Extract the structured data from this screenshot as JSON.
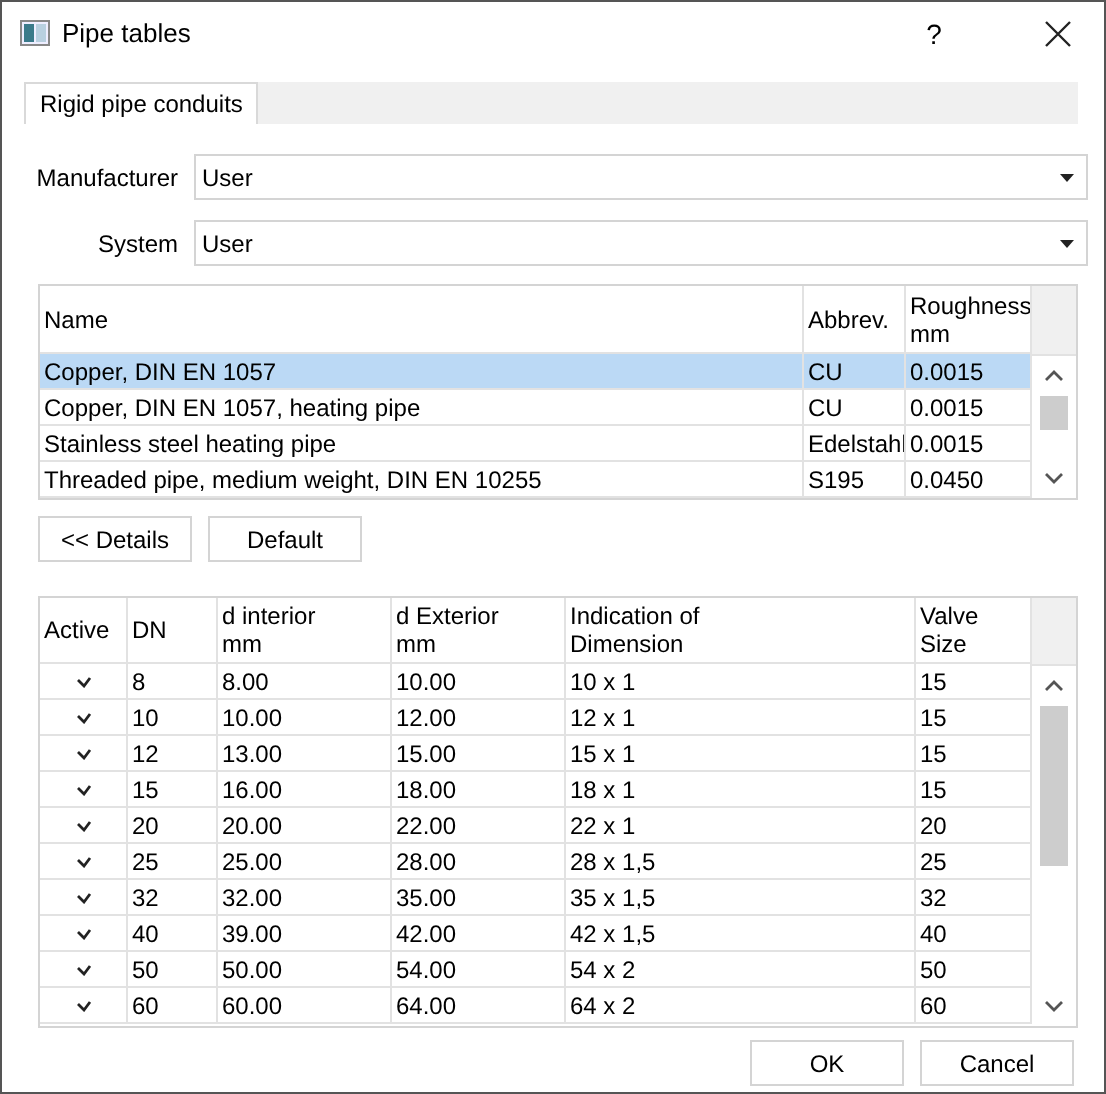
{
  "window": {
    "title": "Pipe tables",
    "help": "?"
  },
  "tabs": [
    {
      "label": "Rigid pipe conduits",
      "selected": true
    }
  ],
  "fields": [
    {
      "label": "Manufacturer",
      "value": "User"
    },
    {
      "label": "System",
      "value": "User"
    }
  ],
  "materials": {
    "columns": [
      "Name",
      "Abbrev.",
      "Roughness\nmm"
    ],
    "rows": [
      {
        "cells": [
          "Copper, DIN EN 1057",
          "CU",
          "0.0015"
        ],
        "selected": true
      },
      {
        "cells": [
          "Copper, DIN EN 1057, heating pipe",
          "CU",
          "0.0015"
        ],
        "selected": false
      },
      {
        "cells": [
          "Stainless steel heating pipe",
          "Edelstahl",
          "0.0015"
        ],
        "selected": false
      },
      {
        "cells": [
          "Threaded pipe, medium weight, DIN EN 10255",
          "S195",
          "0.0450"
        ],
        "selected": false
      }
    ]
  },
  "material_buttons": [
    "<< Details",
    "Default"
  ],
  "sizes": {
    "active_column": "Active",
    "columns": [
      "DN",
      "d interior\nmm",
      "d Exterior\nmm",
      "Indication of\nDimension",
      "Valve\nSize"
    ],
    "rows": [
      {
        "active": true,
        "cells": [
          "8",
          "8.00",
          "10.00",
          "10 x 1",
          "15"
        ]
      },
      {
        "active": true,
        "cells": [
          "10",
          "10.00",
          "12.00",
          "12 x 1",
          "15"
        ]
      },
      {
        "active": true,
        "cells": [
          "12",
          "13.00",
          "15.00",
          "15 x 1",
          "15"
        ]
      },
      {
        "active": true,
        "cells": [
          "15",
          "16.00",
          "18.00",
          "18 x 1",
          "15"
        ]
      },
      {
        "active": true,
        "cells": [
          "20",
          "20.00",
          "22.00",
          "22 x 1",
          "20"
        ]
      },
      {
        "active": true,
        "cells": [
          "25",
          "25.00",
          "28.00",
          "28 x 1,5",
          "25"
        ]
      },
      {
        "active": true,
        "cells": [
          "32",
          "32.00",
          "35.00",
          "35 x 1,5",
          "32"
        ]
      },
      {
        "active": true,
        "cells": [
          "40",
          "39.00",
          "42.00",
          "42 x 1,5",
          "40"
        ]
      },
      {
        "active": true,
        "cells": [
          "50",
          "50.00",
          "54.00",
          "54 x 2",
          "50"
        ]
      },
      {
        "active": true,
        "cells": [
          "60",
          "60.00",
          "64.00",
          "64 x 2",
          "60"
        ]
      }
    ]
  },
  "buttons": [
    "OK",
    "Cancel"
  ]
}
